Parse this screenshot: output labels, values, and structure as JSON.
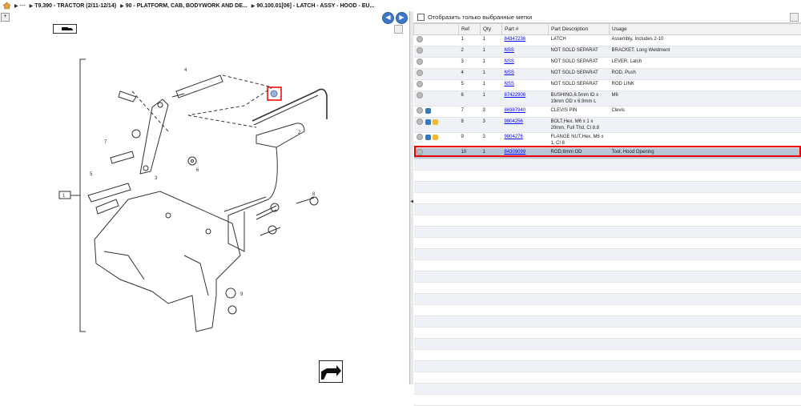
{
  "breadcrumb": [
    {
      "label": "---"
    },
    {
      "label": "T9.390 - TRACTOR (2/11-12/14)"
    },
    {
      "label": "90 - PLATFORM, CAB, BODYWORK AND DE..."
    },
    {
      "label": "90.100.01[06] - LATCH - ASSY - HOOD - EU..."
    }
  ],
  "filter": {
    "checkbox_label": "Отобразить только выбранные метки"
  },
  "table": {
    "headers": [
      "",
      "Ref",
      "Qty",
      "Part #",
      "Part Description",
      "Usage"
    ],
    "rows": [
      {
        "ref": "1",
        "qty": "1",
        "part": "84347236",
        "desc": "LATCH",
        "usage": "Assembly, Includes 2-10",
        "icons": []
      },
      {
        "ref": "2",
        "qty": "1",
        "part": "NSS",
        "desc": "NOT SOLD SEPARAT",
        "usage": "BRACKET, Long Weldment",
        "icons": []
      },
      {
        "ref": "3",
        "qty": "1",
        "part": "NSS",
        "desc": "NOT SOLD SEPARAT",
        "usage": "LEVER, Latch",
        "icons": []
      },
      {
        "ref": "4",
        "qty": "1",
        "part": "NSS",
        "desc": "NOT SOLD SEPARAT",
        "usage": "ROD, Push",
        "icons": []
      },
      {
        "ref": "5",
        "qty": "1",
        "part": "NSS",
        "desc": "NOT SOLD SEPARAT",
        "usage": "ROD LINK",
        "icons": []
      },
      {
        "ref": "6",
        "qty": "1",
        "part": "87422906",
        "desc": "BUSHING,6.5mm ID x 19mm OD x 6.9mm L",
        "usage": "M6",
        "icons": []
      },
      {
        "ref": "7",
        "qty": "3",
        "part": "86987940",
        "desc": "CLEVIS PIN",
        "usage": "Clevis",
        "icons": [
          "blue"
        ]
      },
      {
        "ref": "8",
        "qty": "3",
        "part": "9804256",
        "desc": "BOLT,Hex, M6 x 1 x 20mm, Full Thd, Cl 8.8",
        "usage": "",
        "icons": [
          "blue",
          "yellow"
        ]
      },
      {
        "ref": "9",
        "qty": "3",
        "part": "9804276",
        "desc": "FLANGE NUT,Hex, M6 x 1, Cl 8",
        "usage": "",
        "icons": [
          "blue",
          "yellow"
        ]
      },
      {
        "ref": "10",
        "qty": "1",
        "part": "84309099",
        "desc": "ROD,6mm OD",
        "usage": "Tool, Hood Opening",
        "icons": []
      }
    ]
  },
  "diagram": {
    "callouts": [
      "1",
      "2",
      "3",
      "4",
      "5",
      "6",
      "7",
      "8",
      "9"
    ]
  }
}
